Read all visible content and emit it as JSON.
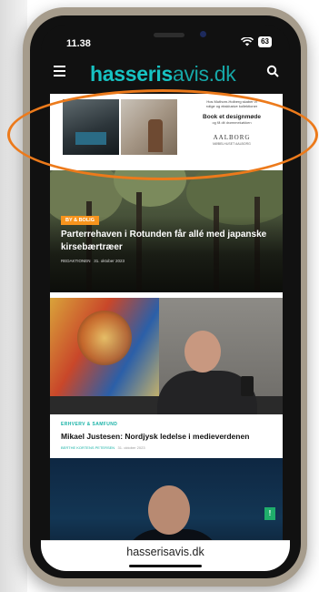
{
  "status_bar": {
    "time": "11.38",
    "battery": "63"
  },
  "header": {
    "logo_bold": "hasseris",
    "logo_light": "avis.dk",
    "menu_icon": "hamburger-menu-icon",
    "search_icon": "search-icon"
  },
  "ad": {
    "small_text_1": "Hos Muthorn-Holberg skaber vi",
    "small_text_2": "rolige og eksklusive kollektioner",
    "headline_1": "Book et designmøde",
    "subtext": "og få dit drømmekøkken",
    "brand": "AALBORG",
    "brand_sub": "MØBELHUSET AALBORG"
  },
  "articles": [
    {
      "category": "BY & BOLIG",
      "title": "Parterrehaven i Rotunden får allé med japanske kirsebærtræer",
      "author": "REDAKTIONEN",
      "date": "31. oktober 2023"
    },
    {
      "category": "ERHVERV & SAMFUND",
      "title": "Mikael Justesen: Nordjysk ledelse i medieverdenen",
      "author": "BERTHE KORTENS PETERSEN",
      "date": "31. oktober 2023"
    }
  ],
  "browser": {
    "url": "hasserisavis.dk"
  },
  "colors": {
    "brand_teal": "#17c2c2",
    "category_orange": "#f7941d",
    "highlight_orange": "#ec7a1b",
    "frame_taupe": "#a69c8c"
  }
}
